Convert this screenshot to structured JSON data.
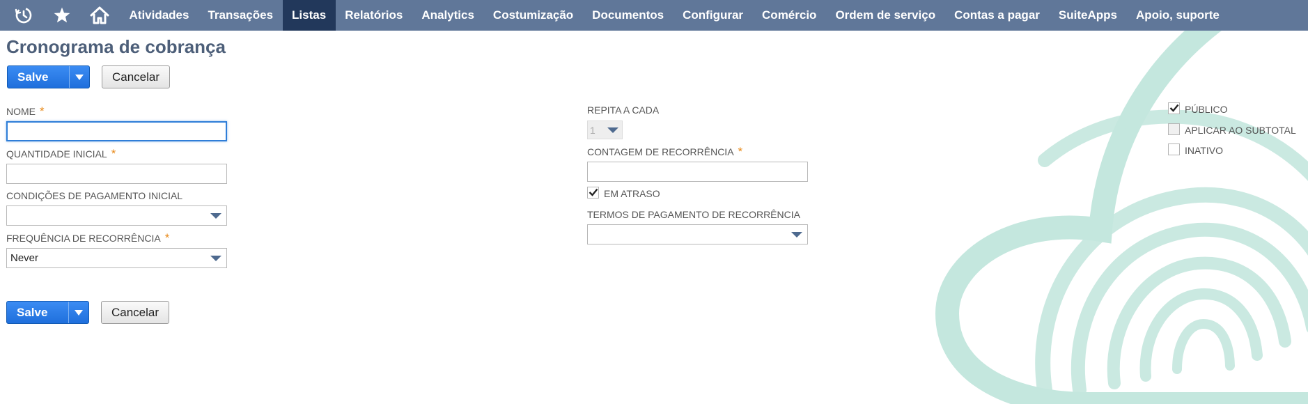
{
  "nav": {
    "icons": [
      "recent-history-icon",
      "star-icon",
      "home-icon"
    ],
    "items": [
      {
        "label": "Atividades"
      },
      {
        "label": "Transações"
      },
      {
        "label": "Listas",
        "active": true
      },
      {
        "label": "Relatórios"
      },
      {
        "label": "Analytics"
      },
      {
        "label": "Costumização"
      },
      {
        "label": "Documentos"
      },
      {
        "label": "Configurar"
      },
      {
        "label": "Comércio"
      },
      {
        "label": "Ordem de serviço"
      },
      {
        "label": "Contas a pagar"
      },
      {
        "label": "SuiteApps"
      },
      {
        "label": "Apoio, suporte"
      }
    ]
  },
  "page": {
    "title": "Cronograma de cobrança"
  },
  "buttons": {
    "save": "Salve",
    "cancel": "Cancelar"
  },
  "form": {
    "nome": {
      "label": "NOME",
      "required": "*",
      "value": ""
    },
    "quantidade_inicial": {
      "label": "QUANTIDADE INICIAL",
      "required": "*",
      "value": ""
    },
    "condicoes_pagamento_inicial": {
      "label": "CONDIÇÕES DE PAGAMENTO INICIAL",
      "value": ""
    },
    "frequencia_recorrencia": {
      "label": "FREQUÊNCIA DE RECORRÊNCIA",
      "required": "*",
      "value": "Never"
    },
    "repita_a_cada": {
      "label": "REPITA A CADA",
      "value": "1"
    },
    "contagem_recorrencia": {
      "label": "CONTAGEM DE RECORRÊNCIA",
      "required": "*",
      "value": ""
    },
    "em_atraso": {
      "label": "EM ATRASO",
      "checked": true
    },
    "termos_pagamento_recorrencia": {
      "label": "TERMOS DE PAGAMENTO DE RECORRÊNCIA",
      "value": ""
    },
    "publico": {
      "label": "PÚBLICO",
      "checked": true
    },
    "aplicar_ao_subtotal": {
      "label": "APLICAR AO SUBTOTAL",
      "checked": false,
      "disabled": true
    },
    "inativo": {
      "label": "INATIVO",
      "checked": false
    }
  },
  "colors": {
    "nav_bg": "#607799",
    "nav_active": "#22385b",
    "title": "#4d5f79",
    "primary_button": "#2a7be6",
    "required_asterisk": "#e88a1a",
    "background_art": "#c4e7de"
  }
}
